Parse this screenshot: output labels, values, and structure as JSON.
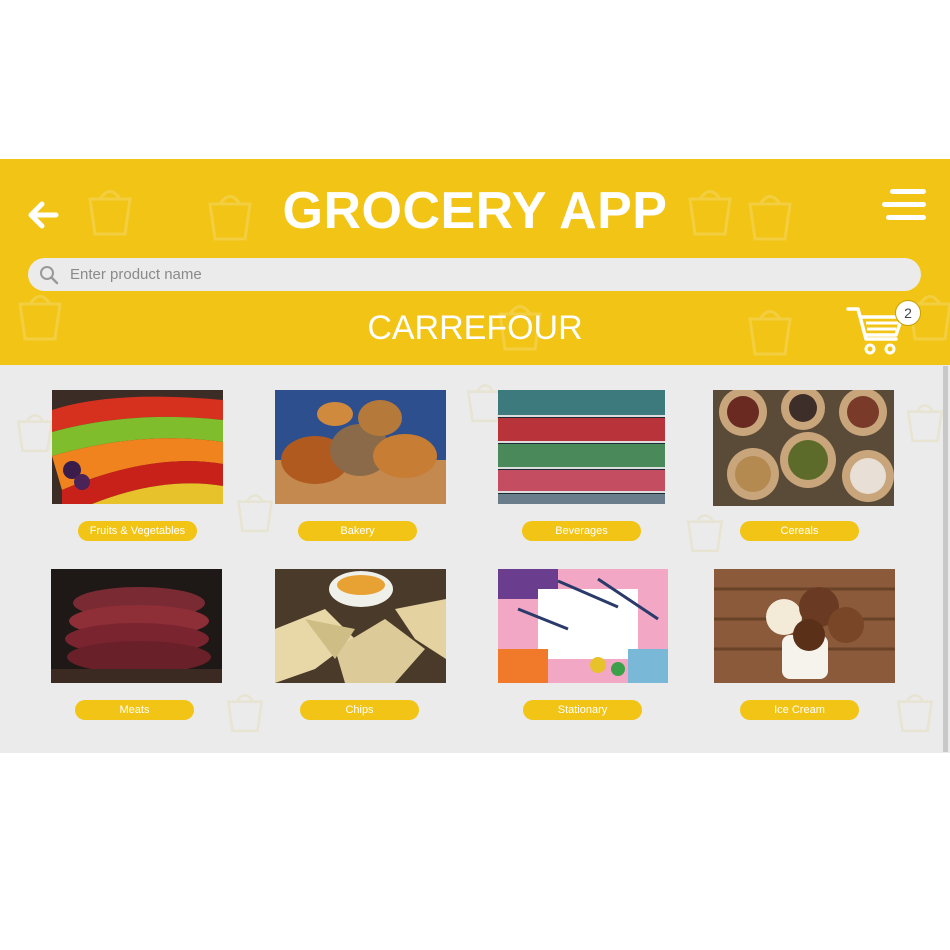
{
  "header": {
    "title": "GROCERY APP",
    "back_icon": "arrow-left-icon",
    "menu_icon": "hamburger-menu-icon",
    "bg_color": "#f1c416"
  },
  "search": {
    "placeholder": "Enter product name",
    "icon": "search-icon"
  },
  "store": {
    "name": "CARREFOUR"
  },
  "cart": {
    "icon": "shopping-cart-icon",
    "count": "2"
  },
  "categories": [
    {
      "label": "Fruits & Vegetables",
      "image": "fruits-vegetables-photo"
    },
    {
      "label": "Bakery",
      "image": "bakery-photo"
    },
    {
      "label": "Beverages",
      "image": "beverages-photo"
    },
    {
      "label": "Cereals",
      "image": "cereals-photo"
    },
    {
      "label": "Meats",
      "image": "meats-photo"
    },
    {
      "label": "Chips",
      "image": "chips-photo"
    },
    {
      "label": "Stationary",
      "image": "stationary-photo"
    },
    {
      "label": "Ice Cream",
      "image": "ice-cream-photo"
    }
  ]
}
